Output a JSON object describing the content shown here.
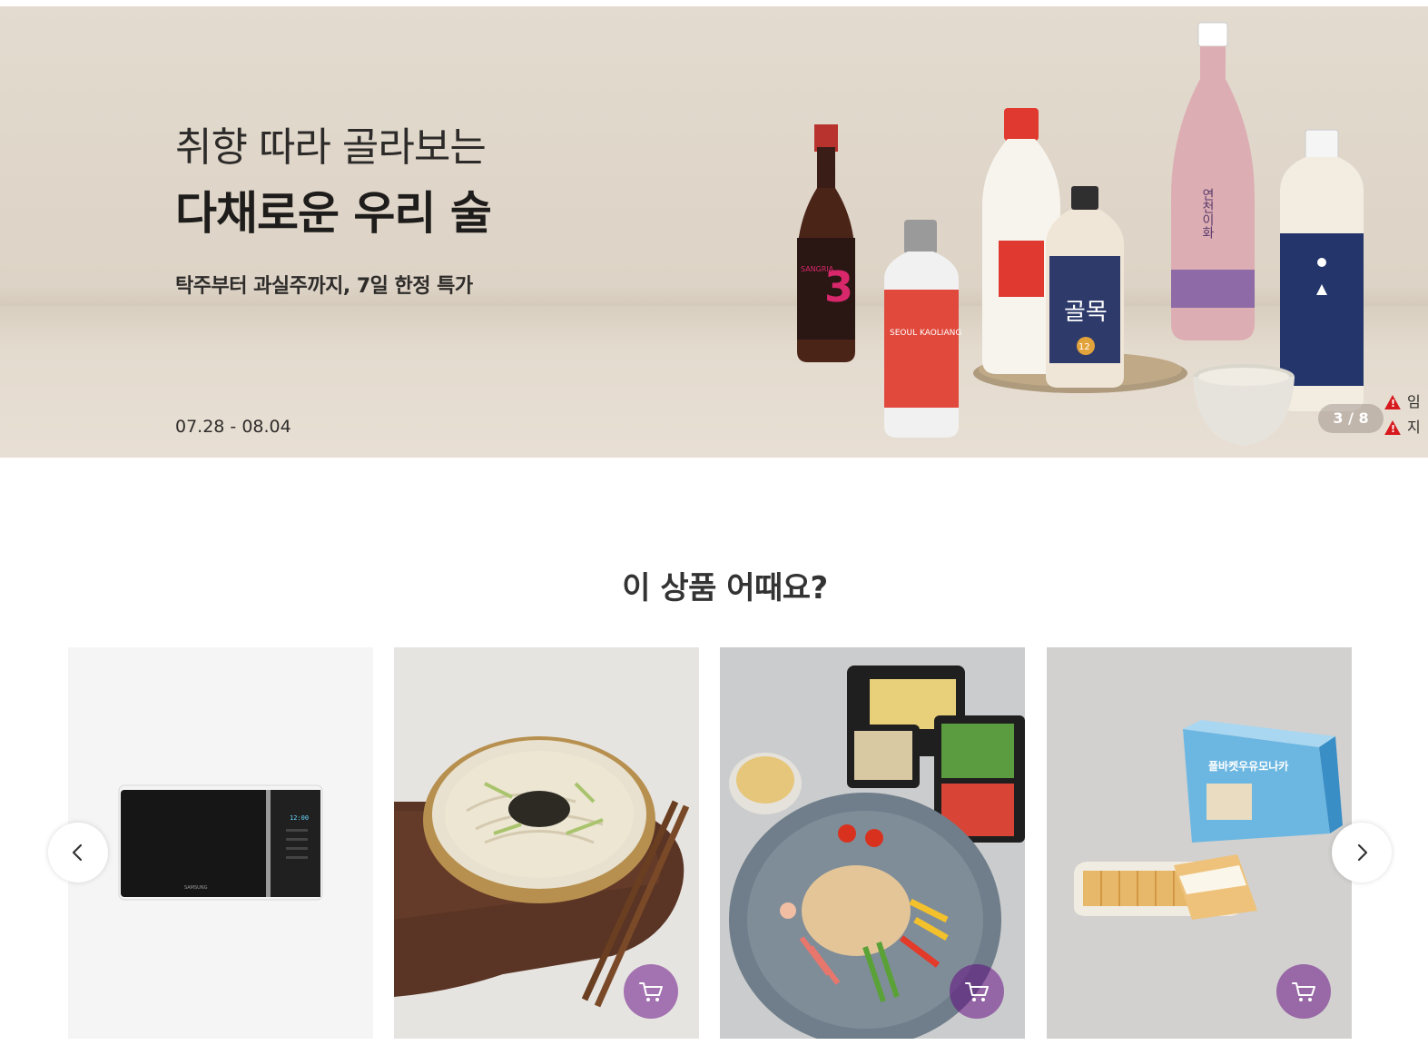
{
  "banner": {
    "subtitle": "취향 따라 골라보는",
    "title": "다채로운 우리 술",
    "description": "탁주부터 과실주까지, 7일 한정 특가",
    "date": "07.28 - 08.04",
    "counter": "3 / 8",
    "warnings": [
      "임",
      "지"
    ],
    "bottle_labels": {
      "sangria_number": "3",
      "sangria_name": "SANGRIA",
      "seoul_name": "SEOUL KAOLIANG",
      "golmok_name": "골목",
      "golmok_number": "12",
      "pink_name": "연천이화"
    }
  },
  "section": {
    "title": "이 상품 어때요?"
  },
  "products": [
    {
      "name": "microwave",
      "has_cart": false,
      "brand_text": "SAMSUNG",
      "display": "12:00"
    },
    {
      "name": "noodle-soup",
      "has_cart": true
    },
    {
      "name": "jellyfish-salad",
      "has_cart": true
    },
    {
      "name": "ice-cream-sandwich",
      "has_cart": true,
      "box_text": "플바켓우유모나카"
    }
  ],
  "colors": {
    "accent": "#5f0080",
    "cart_button": "rgba(95,0,128,0.5)",
    "warning": "#d7191d"
  },
  "icons": {
    "prev": "chevron-left-icon",
    "next": "chevron-right-icon",
    "cart": "cart-icon",
    "warning": "warning-icon"
  }
}
